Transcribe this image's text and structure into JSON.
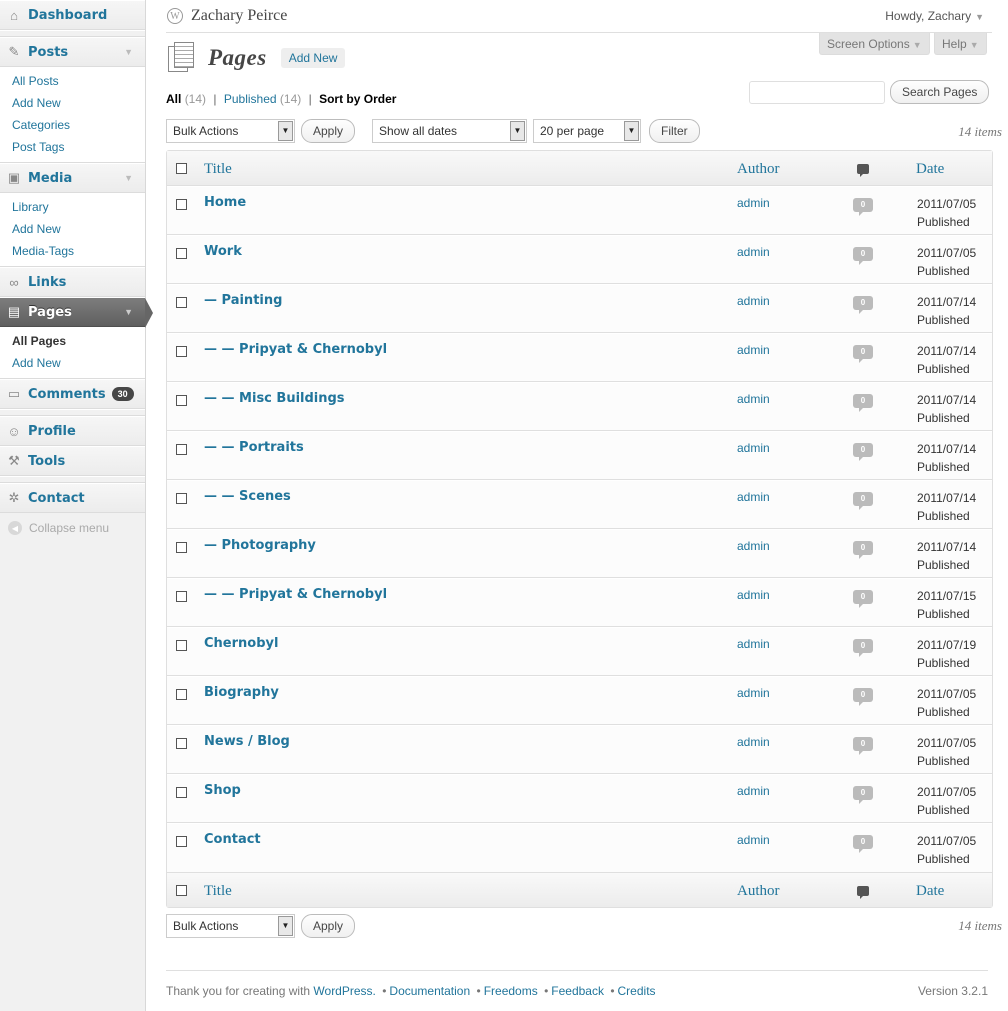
{
  "sidebar": {
    "dashboard": "Dashboard",
    "posts": {
      "label": "Posts",
      "items": [
        "All Posts",
        "Add New",
        "Categories",
        "Post Tags"
      ]
    },
    "media": {
      "label": "Media",
      "items": [
        "Library",
        "Add New",
        "Media-Tags"
      ]
    },
    "links": "Links",
    "pages": {
      "label": "Pages",
      "items": [
        "All Pages",
        "Add New"
      ]
    },
    "comments": {
      "label": "Comments",
      "badge": "30"
    },
    "profile": "Profile",
    "tools": "Tools",
    "contact": "Contact",
    "collapse": "Collapse menu"
  },
  "header": {
    "site_name": "Zachary Peirce",
    "howdy": "Howdy, Zachary",
    "screen_options": "Screen Options",
    "help": "Help"
  },
  "page": {
    "title": "Pages",
    "add_new": "Add New"
  },
  "filters": {
    "all": "All",
    "all_count": "(14)",
    "published": "Published",
    "published_count": "(14)",
    "sort_by_order": "Sort by Order"
  },
  "search": {
    "button": "Search Pages",
    "value": ""
  },
  "toolbar": {
    "bulk_actions": "Bulk Actions",
    "apply": "Apply",
    "dates": "Show all dates",
    "per_page": "20 per page",
    "filter": "Filter",
    "items": "14 items"
  },
  "table": {
    "columns": {
      "title": "Title",
      "author": "Author",
      "date": "Date"
    },
    "rows": [
      {
        "title": "Home",
        "author": "admin",
        "comments": "0",
        "date": "2011/07/05",
        "status": "Published"
      },
      {
        "title": "Work",
        "author": "admin",
        "comments": "0",
        "date": "2011/07/05",
        "status": "Published"
      },
      {
        "title": "— Painting",
        "author": "admin",
        "comments": "0",
        "date": "2011/07/14",
        "status": "Published"
      },
      {
        "title": "— — Pripyat & Chernobyl",
        "author": "admin",
        "comments": "0",
        "date": "2011/07/14",
        "status": "Published"
      },
      {
        "title": "— — Misc Buildings",
        "author": "admin",
        "comments": "0",
        "date": "2011/07/14",
        "status": "Published"
      },
      {
        "title": "— — Portraits",
        "author": "admin",
        "comments": "0",
        "date": "2011/07/14",
        "status": "Published"
      },
      {
        "title": "— — Scenes",
        "author": "admin",
        "comments": "0",
        "date": "2011/07/14",
        "status": "Published"
      },
      {
        "title": "— Photography",
        "author": "admin",
        "comments": "0",
        "date": "2011/07/14",
        "status": "Published"
      },
      {
        "title": "— — Pripyat & Chernobyl",
        "author": "admin",
        "comments": "0",
        "date": "2011/07/15",
        "status": "Published"
      },
      {
        "title": "Chernobyl",
        "author": "admin",
        "comments": "0",
        "date": "2011/07/19",
        "status": "Published"
      },
      {
        "title": "Biography",
        "author": "admin",
        "comments": "0",
        "date": "2011/07/05",
        "status": "Published"
      },
      {
        "title": "News / Blog",
        "author": "admin",
        "comments": "0",
        "date": "2011/07/05",
        "status": "Published"
      },
      {
        "title": "Shop",
        "author": "admin",
        "comments": "0",
        "date": "2011/07/05",
        "status": "Published"
      },
      {
        "title": "Contact",
        "author": "admin",
        "comments": "0",
        "date": "2011/07/05",
        "status": "Published"
      }
    ]
  },
  "footer": {
    "thanks": "Thank you for creating with ",
    "wordpress": "WordPress.",
    "documentation": "Documentation",
    "freedoms": "Freedoms",
    "feedback": "Feedback",
    "credits": "Credits",
    "version": "Version 3.2.1"
  }
}
